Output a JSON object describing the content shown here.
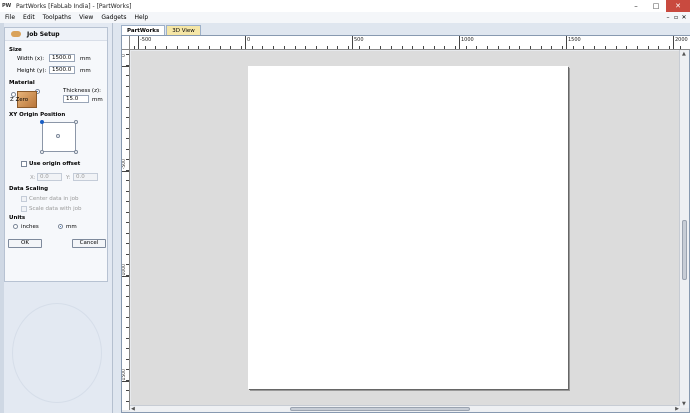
{
  "window": {
    "icon_text": "PW",
    "title": "PartWorks [FabLab India] - [PartWorks]",
    "minimize": "–",
    "maximize": "□",
    "close": "✕"
  },
  "menu": {
    "items": [
      "File",
      "Edit",
      "Toolpaths",
      "View",
      "Gadgets",
      "Help"
    ],
    "mdi_minimize": "–",
    "mdi_restore": "▫",
    "mdi_close": "✕"
  },
  "job_setup": {
    "title": "Job Setup",
    "size_label": "Size",
    "width_label": "Width (x):",
    "width_value": "1500.0",
    "width_unit": "mm",
    "height_label": "Height (y):",
    "height_value": "1500.0",
    "height_unit": "mm",
    "material_label": "Material",
    "zzero_label": "Z Zero",
    "thickness_label": "Thickness (z):",
    "thickness_value": "15.0",
    "thickness_unit": "mm",
    "xy_origin_label": "XY Origin Position",
    "use_origin_offset_label": "Use origin offset",
    "x_label": "X:",
    "x_value": "0.0",
    "y_label": "Y:",
    "y_value": "0.0",
    "data_scaling_label": "Data Scaling",
    "center_data_label": "Center data in job",
    "scale_data_label": "Scale data with job",
    "units_label": "Units",
    "inches_label": "inches",
    "mm_label": "mm",
    "selected_unit": "mm",
    "ok_label": "OK",
    "cancel_label": "Cancel"
  },
  "document": {
    "tabs": [
      {
        "label": "PartWorks",
        "active": true
      },
      {
        "label": "3D View",
        "active": false
      }
    ],
    "hruler_labels": [
      "-500",
      "0",
      "500",
      "1000",
      "1500",
      "2000"
    ],
    "vruler_labels": [
      "0",
      "-500",
      "-1000",
      "-1500"
    ]
  },
  "colors": {
    "accent": "#1b5fc4",
    "close_button": "#c94a3f",
    "material": "#d9a25a",
    "tab_inactive": "#f5e6a6"
  }
}
